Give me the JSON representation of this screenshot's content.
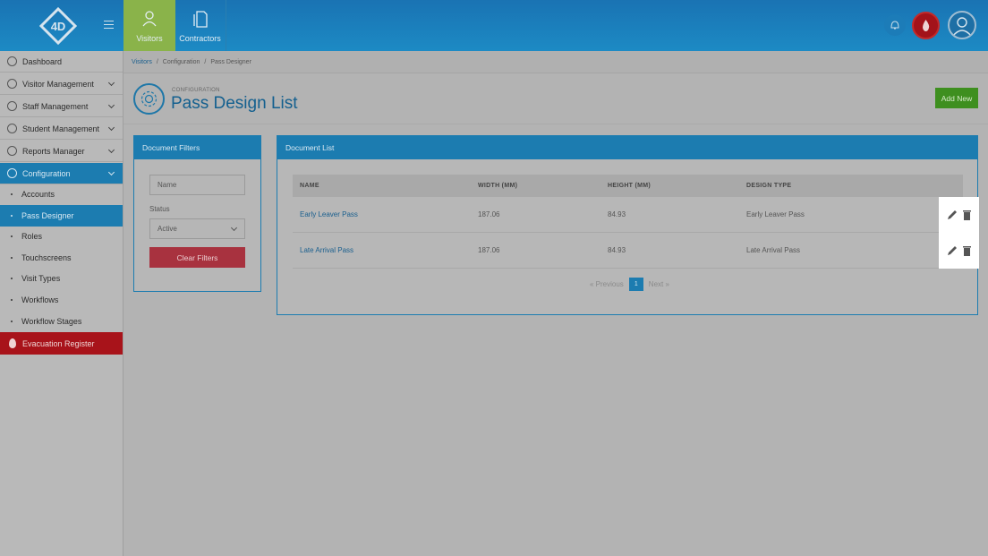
{
  "topbar": {
    "tabs": [
      {
        "label": "Visitors",
        "icon": "person-icon"
      },
      {
        "label": "Contractors",
        "icon": "document-icon"
      }
    ]
  },
  "sidebar": {
    "items": [
      {
        "label": "Dashboard"
      },
      {
        "label": "Visitor Management"
      },
      {
        "label": "Staff Management"
      },
      {
        "label": "Student Management"
      },
      {
        "label": "Reports Manager"
      },
      {
        "label": "Configuration"
      }
    ],
    "sub_items": [
      {
        "label": "Accounts"
      },
      {
        "label": "Pass Designer"
      },
      {
        "label": "Roles"
      },
      {
        "label": "Touchscreens"
      },
      {
        "label": "Visit Types"
      },
      {
        "label": "Workflows"
      },
      {
        "label": "Workflow Stages"
      }
    ],
    "evacuation": "Evacuation Register"
  },
  "breadcrumb": [
    "Visitors",
    "Configuration",
    "Pass Designer"
  ],
  "header": {
    "kicker": "CONFIGURATION",
    "title": "Pass Design List",
    "add_new": "Add New"
  },
  "filters": {
    "title": "Document Filters",
    "name_placeholder": "Name",
    "status_label": "Status",
    "status_value": "Active",
    "clear_label": "Clear Filters"
  },
  "doclist": {
    "title": "Document List",
    "columns": [
      "NAME",
      "WIDTH (MM)",
      "HEIGHT (MM)",
      "DESIGN TYPE"
    ],
    "rows": [
      {
        "name": "Early Leaver Pass",
        "width": "187.06",
        "height": "84.93",
        "type": "Early Leaver Pass"
      },
      {
        "name": "Late Arrival Pass",
        "width": "187.06",
        "height": "84.93",
        "type": "Late Arrival Pass"
      }
    ],
    "pager": {
      "prev": "« Previous",
      "page": "1",
      "next": "Next »"
    }
  },
  "colors": {
    "primary": "#1c7cb0",
    "success": "#3e8f1f",
    "danger": "#a8131a"
  }
}
